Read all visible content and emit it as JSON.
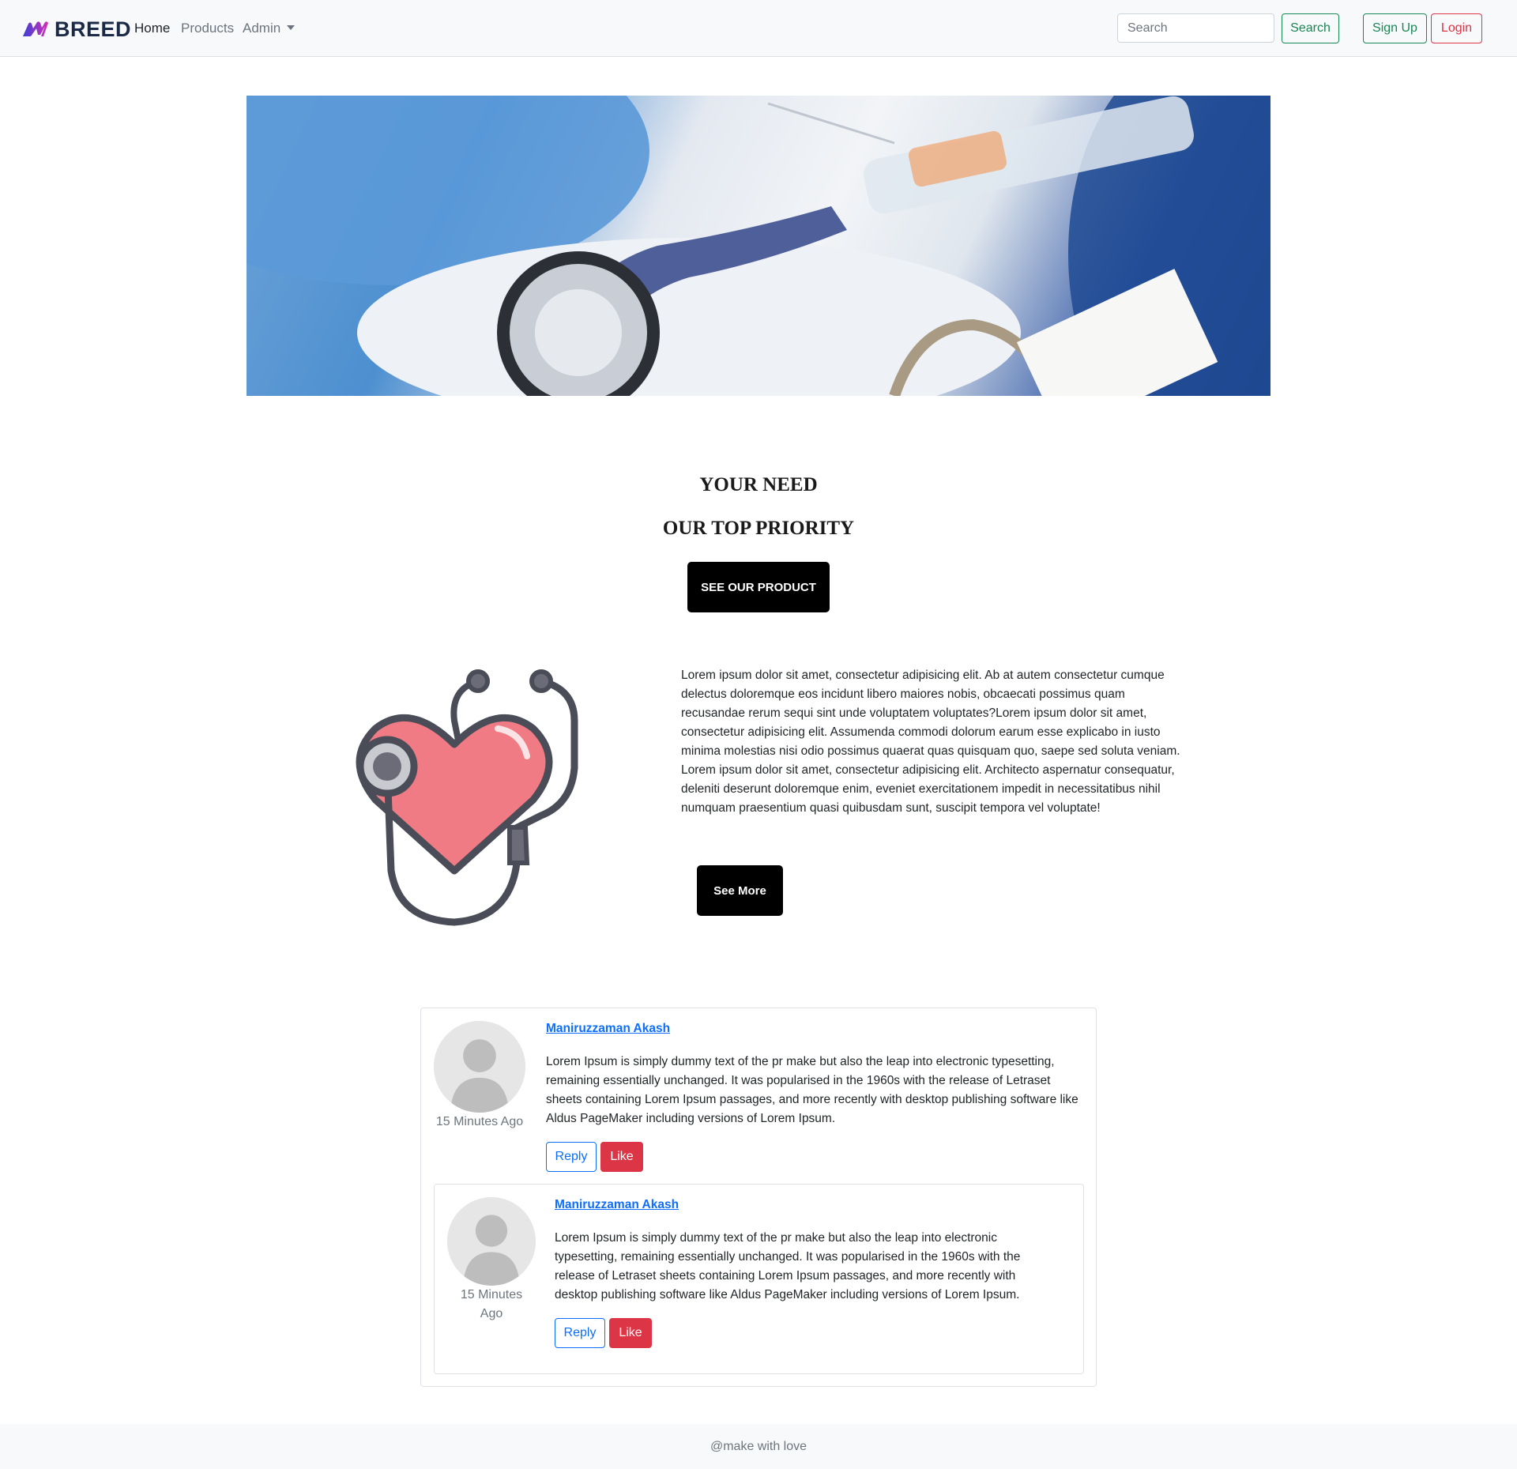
{
  "navbar": {
    "brand": "BREED",
    "links": {
      "home": "Home",
      "products": "Products",
      "admin": "Admin"
    },
    "search": {
      "placeholder": "Search",
      "button": "Search"
    },
    "signup": "Sign Up",
    "login": "Login"
  },
  "headline": {
    "line1": "YOUR NEED",
    "line2": "OUR TOP PRIORITY",
    "button": "SEE OUR PRODUCT"
  },
  "about": {
    "text": "Lorem ipsum dolor sit amet, consectetur adipisicing elit. Ab at autem consectetur cumque delectus doloremque eos incidunt libero maiores nobis, obcaecati possimus quam recusandae rerum sequi sint unde voluptatem voluptates?Lorem ipsum dolor sit amet, consectetur adipisicing elit. Assumenda commodi dolorum earum esse explicabo in iusto minima molestias nisi odio possimus quaerat quas quisquam quo, saepe sed soluta veniam. Lorem ipsum dolor sit amet, consectetur adipisicing elit. Architecto aspernatur consequatur, deleniti deserunt doloremque enim, eveniet exercitationem impedit in necessitatibus nihil numquam praesentium quasi quibusdam sunt, suscipit tempora vel voluptate!",
    "button": "See More"
  },
  "comments": [
    {
      "author": "Maniruzzaman Akash",
      "time": "15 Minutes Ago",
      "text": "Lorem Ipsum is simply dummy text of the pr make but also the leap into electronic typesetting, remaining essentially unchanged. It was popularised in the 1960s with the release of Letraset sheets containing Lorem Ipsum passages, and more recently with desktop publishing software like Aldus PageMaker including versions of Lorem Ipsum.",
      "reply": "Reply",
      "like": "Like"
    },
    {
      "author": "Maniruzzaman Akash",
      "time": "15 Minutes Ago",
      "text": "Lorem Ipsum is simply dummy text of the pr make but also the leap into electronic typesetting, remaining essentially unchanged. It was popularised in the 1960s with the release of Letraset sheets containing Lorem Ipsum passages, and more recently with desktop publishing software like Aldus PageMaker including versions of Lorem Ipsum.",
      "reply": "Reply",
      "like": "Like"
    }
  ],
  "footer": {
    "text": "@make with love"
  },
  "colors": {
    "success": "#198754",
    "danger": "#dc3545",
    "primary": "#0d6efd",
    "brand": "#1b2a47",
    "navbar_bg": "#f8f9fa"
  },
  "icons": [
    "brand-logo-icon",
    "caret-down-icon",
    "heart-stethoscope-icon",
    "user-avatar-icon"
  ]
}
